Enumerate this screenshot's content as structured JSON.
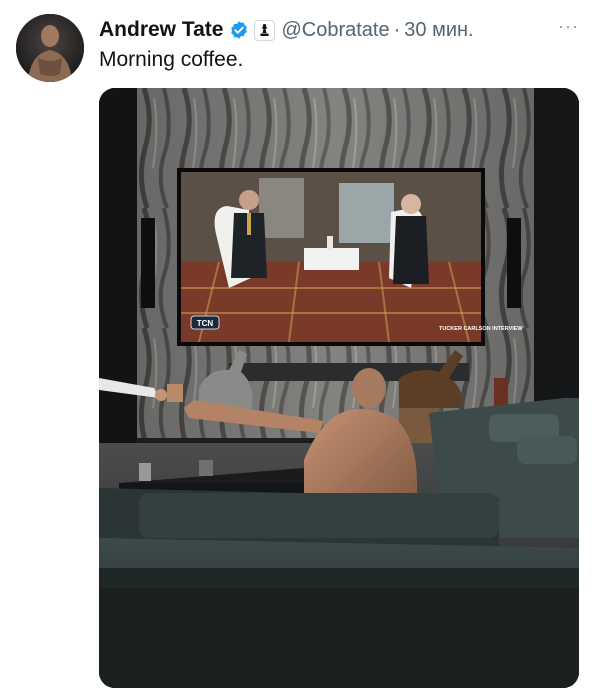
{
  "tweet": {
    "author_name": "Andrew Tate",
    "handle": "@Cobratate",
    "separator": "·",
    "time": "30 мин.",
    "text": "Morning coffee.",
    "more_label": "···",
    "media": {
      "tv_logo": "TCN",
      "tv_caption": "TUCKER CARLSON INTERVIEW"
    }
  },
  "colors": {
    "verified_blue": "#1d9bf0",
    "secondary_text": "#536471"
  }
}
